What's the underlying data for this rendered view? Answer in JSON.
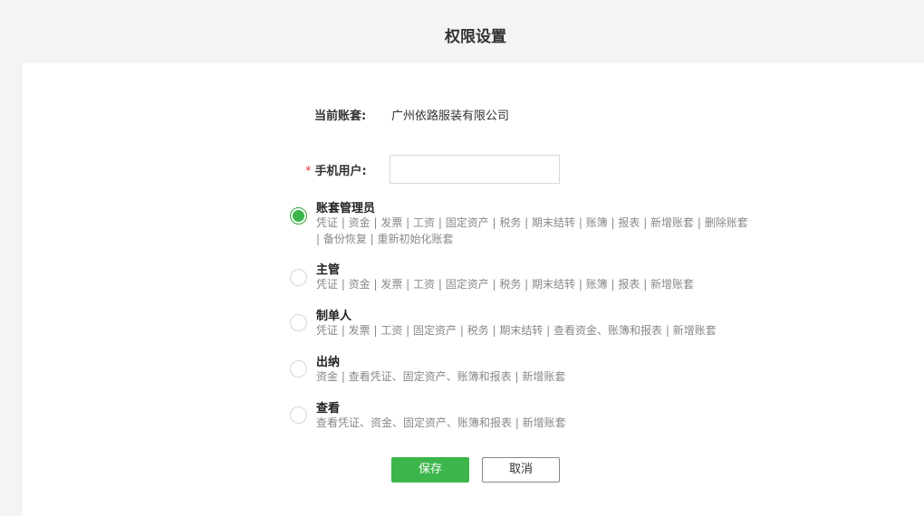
{
  "page": {
    "title": "权限设置"
  },
  "form": {
    "account_label": "当前账套:",
    "account_value": "广州依路服装有限公司",
    "required_mark": "*",
    "phone_label": "手机用户:",
    "phone_value": "",
    "phone_placeholder": ""
  },
  "roles": [
    {
      "name": "账套管理员",
      "desc": "凭证 | 资金 | 发票 | 工资 | 固定资产 | 税务 | 期末结转 | 账簿 | 报表 | 新增账套 | 删除账套 | 备份恢复 | 重新初始化账套",
      "selected": true
    },
    {
      "name": "主管",
      "desc": "凭证 | 资金 | 发票 | 工资 | 固定资产 | 税务 | 期末结转 | 账簿 | 报表 | 新增账套",
      "selected": false
    },
    {
      "name": "制单人",
      "desc": "凭证 | 发票 | 工资 | 固定资产 | 税务 | 期末结转 | 查看资金、账簿和报表 | 新增账套",
      "selected": false
    },
    {
      "name": "出纳",
      "desc": "资金 | 查看凭证、固定资产、账簿和报表 | 新增账套",
      "selected": false
    },
    {
      "name": "查看",
      "desc": "查看凭证、资金、固定资产、账簿和报表 | 新增账套",
      "selected": false
    }
  ],
  "buttons": {
    "save": "保存",
    "cancel": "取消"
  },
  "colors": {
    "accent": "#3cb64a",
    "required": "#e4393c"
  }
}
